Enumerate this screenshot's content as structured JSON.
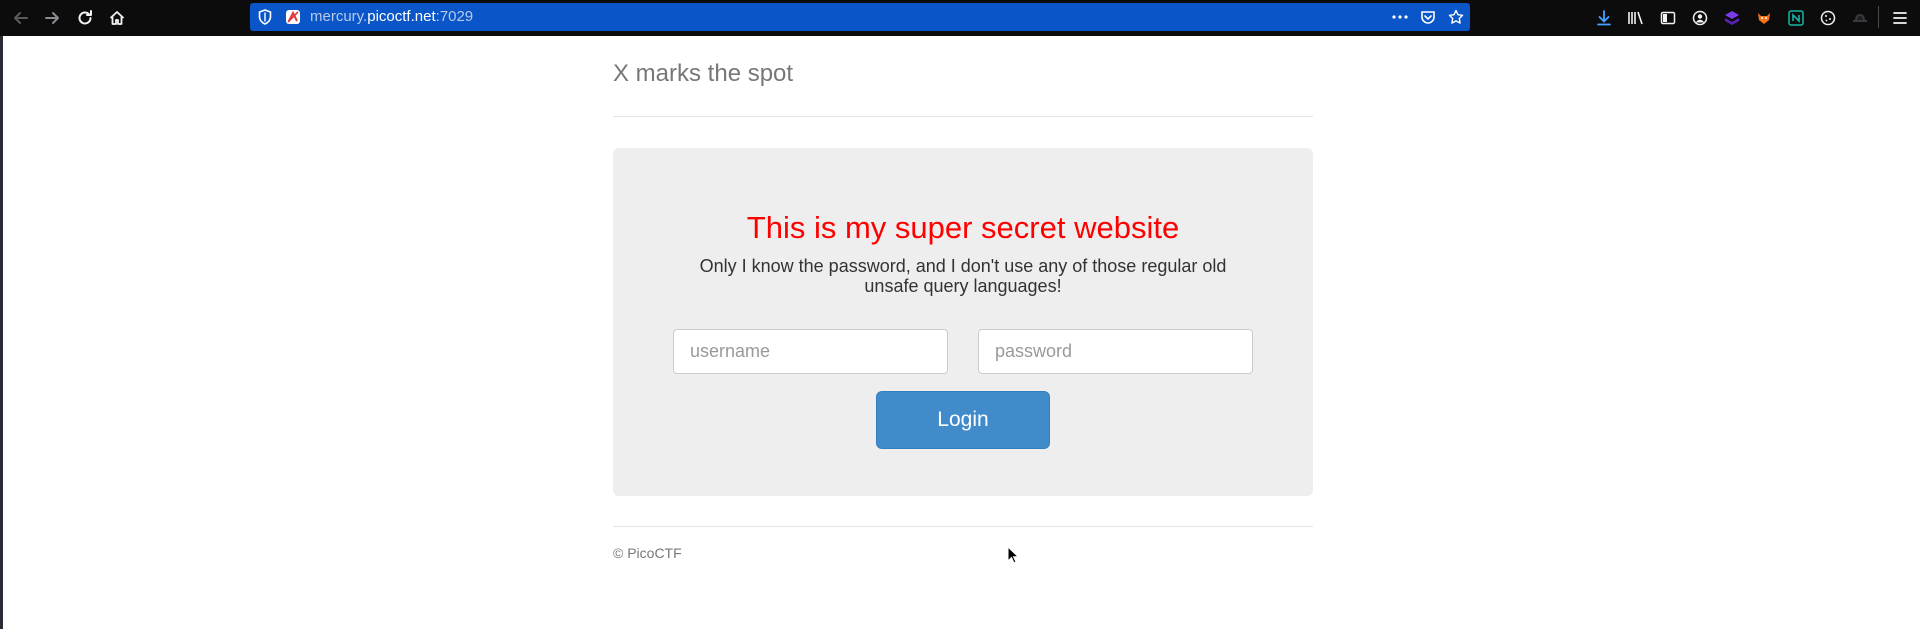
{
  "browser": {
    "url": {
      "subdomain": "mercury.",
      "domain": "picoctf.net",
      "port": ":7029"
    },
    "icons": {
      "back": "arrow-left-icon",
      "forward": "arrow-right-icon",
      "reload": "reload-icon",
      "home": "home-icon",
      "tracking": "shield-icon",
      "site": "site-favicon-icon",
      "page_actions": "ellipsis-icon",
      "pocket": "pocket-icon",
      "bookmark": "star-icon",
      "downloads": "download-icon",
      "library": "library-icon",
      "sidebar": "sidebar-icon",
      "account": "account-icon",
      "extensions": [
        "extension-purple-icon",
        "extension-fox-icon",
        "extension-n-icon",
        "cookie-icon",
        "hat-icon"
      ],
      "menu": "hamburger-menu-icon"
    },
    "colors": {
      "toolbar": "#0c0c0d",
      "urlbar": "#0a56c8"
    }
  },
  "page": {
    "site_title": "X marks the spot",
    "heading": "This is my super secret website",
    "lead": "Only I know the password, and I don't use any of those regular old unsafe query languages!",
    "form": {
      "username_placeholder": "username",
      "password_placeholder": "password",
      "login_label": "Login"
    },
    "footer": "© PicoCTF",
    "colors": {
      "heading": "#ff0000",
      "button": "#428bca",
      "panel": "#eeeeee"
    }
  }
}
